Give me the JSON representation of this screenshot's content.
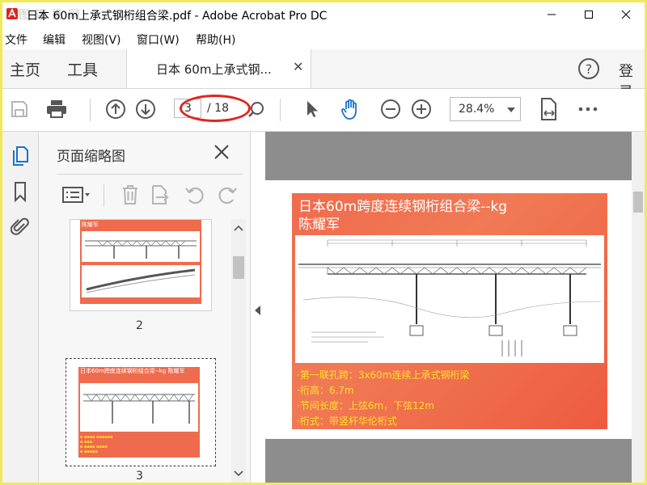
{
  "window": {
    "title": "日本 60m上承式钢桁组合梁.pdf - Adobe Acrobat Pro DC",
    "watermark": "图 连 扬 网"
  },
  "menu": [
    "文件",
    "编辑",
    "视图(V)",
    "窗口(W)",
    "帮助(H)"
  ],
  "tabs": {
    "home": "主页",
    "tools": "工具",
    "document": "日本 60m上承式钢...",
    "login": "登录"
  },
  "toolbar": {
    "current_page": "3",
    "total_pages": "/ 18",
    "zoom": "28.4%",
    "icons": [
      "save-icon",
      "print-icon",
      "page-up-icon",
      "page-down-icon",
      "zoom-search-icon",
      "select-arrow-icon",
      "hand-icon",
      "zoom-out-icon",
      "zoom-in-icon",
      "fit-page-icon",
      "more-icon"
    ]
  },
  "panel": {
    "title": "页面缩略图",
    "thumbnails": [
      {
        "number": "2",
        "label": "陈耀军"
      },
      {
        "number": "3",
        "label": "日本60m跨度连续钢桁组合梁--kg 陈耀军"
      }
    ]
  },
  "slide": {
    "title_line1": "日本60m跨度连续钢桁组合梁--kg",
    "title_line2": "陈耀军",
    "bullets": [
      "·第一联孔跨：3x60m连续上承式钢桁梁",
      "·桁高：6.7m",
      "·节间长度：上弦6m，下弦12m",
      "·桁式：带竖杆华伦桁式"
    ]
  },
  "colors": {
    "accent": "#1a73c8",
    "slide_bg": "#ef6b4d",
    "bullet_text": "#ffe02a",
    "annotation": "#e4231c"
  }
}
